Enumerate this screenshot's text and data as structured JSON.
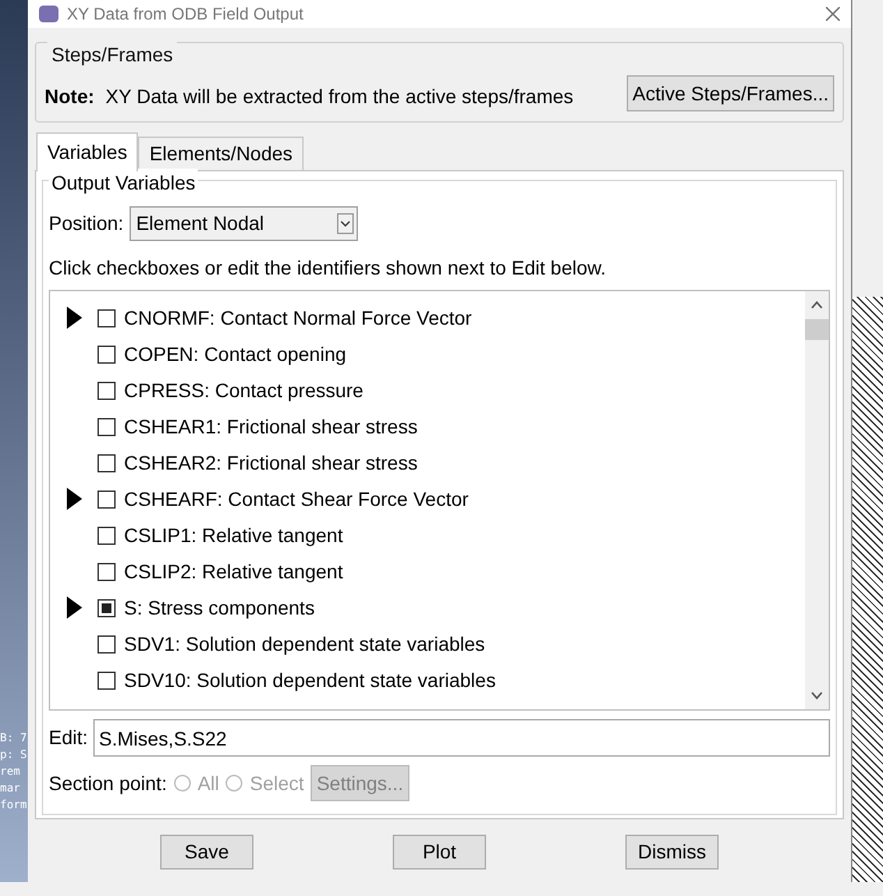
{
  "window": {
    "title": "XY Data from ODB Field Output"
  },
  "background_text": [
    "B: 7",
    "p: S",
    "rem",
    "mar",
    "form"
  ],
  "steps_frames": {
    "title": "Steps/Frames",
    "note_label": "Note:",
    "note": "XY Data will be extracted from the active steps/frames",
    "button": "Active Steps/Frames..."
  },
  "tabs": [
    {
      "label": "Variables",
      "selected": true
    },
    {
      "label": "Elements/Nodes",
      "selected": false
    }
  ],
  "output_variables": {
    "title": "Output Variables",
    "position_label": "Position:",
    "position": "Element Nodal",
    "instruction": "Click checkboxes or edit the identifiers shown next to Edit below.",
    "items": [
      {
        "label": "CNORMF: Contact Normal Force Vector",
        "expandable": true,
        "checked": false
      },
      {
        "label": "COPEN: Contact opening",
        "expandable": false,
        "checked": false
      },
      {
        "label": "CPRESS: Contact pressure",
        "expandable": false,
        "checked": false
      },
      {
        "label": "CSHEAR1: Frictional shear stress",
        "expandable": false,
        "checked": false
      },
      {
        "label": "CSHEAR2: Frictional shear stress",
        "expandable": false,
        "checked": false
      },
      {
        "label": "CSHEARF: Contact Shear Force Vector",
        "expandable": true,
        "checked": false
      },
      {
        "label": "CSLIP1: Relative tangent",
        "expandable": false,
        "checked": false
      },
      {
        "label": "CSLIP2: Relative tangent",
        "expandable": false,
        "checked": false
      },
      {
        "label": "S: Stress components",
        "expandable": true,
        "checked": true
      },
      {
        "label": "SDV1: Solution dependent state variables",
        "expandable": false,
        "checked": false
      },
      {
        "label": "SDV10: Solution dependent state variables",
        "expandable": false,
        "checked": false
      }
    ],
    "edit_label": "Edit:",
    "edit_value": "S.Mises,S.S22",
    "section_point": {
      "label": "Section point:",
      "options": [
        {
          "label": "All",
          "selected": false,
          "disabled": true
        },
        {
          "label": "Select",
          "selected": false,
          "disabled": true
        }
      ],
      "settings_button": "Settings...",
      "disabled": true
    }
  },
  "buttons": [
    "Save",
    "Plot",
    "Dismiss"
  ]
}
